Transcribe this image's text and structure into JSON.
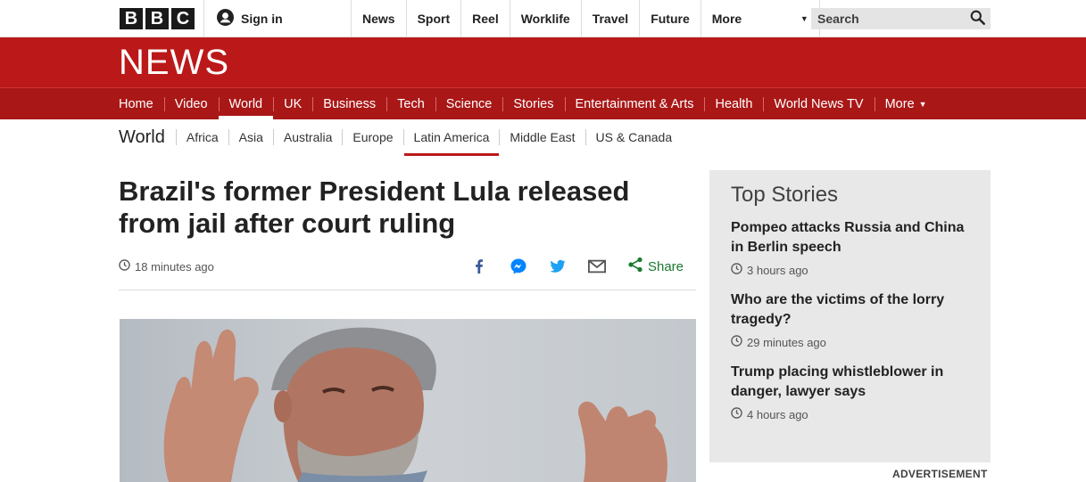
{
  "brand": {
    "logo_letters": [
      "B",
      "B",
      "C"
    ],
    "news_wordmark": "NEWS"
  },
  "account": {
    "signin_label": "Sign in"
  },
  "global_nav": {
    "items": [
      "News",
      "Sport",
      "Reel",
      "Worklife",
      "Travel",
      "Future"
    ],
    "more_label": "More",
    "search_placeholder": "Search"
  },
  "section_nav": {
    "items": [
      "Home",
      "Video",
      "World",
      "UK",
      "Business",
      "Tech",
      "Science",
      "Stories",
      "Entertainment & Arts",
      "Health",
      "World News TV"
    ],
    "active": "World",
    "more_label": "More"
  },
  "world_nav": {
    "title": "World",
    "items": [
      "Africa",
      "Asia",
      "Australia",
      "Europe",
      "Latin America",
      "Middle East",
      "US & Canada"
    ],
    "active": "Latin America"
  },
  "article": {
    "headline": "Brazil's former President Lula released from jail after court ruling",
    "timestamp": "18 minutes ago",
    "share_label": "Share"
  },
  "top_stories": {
    "title": "Top Stories",
    "items": [
      {
        "title": "Pompeo attacks Russia and China in Berlin speech",
        "time": "3 hours ago"
      },
      {
        "title": "Who are the victims of the lorry tragedy?",
        "time": "29 minutes ago"
      },
      {
        "title": "Trump placing whistleblower in danger, lawyer says",
        "time": "4 hours ago"
      }
    ]
  },
  "advertisement_label": "ADVERTISEMENT",
  "colors": {
    "brand_red": "#bb1919",
    "nav_red": "#a91717",
    "share_green": "#1a7a2e",
    "facebook": "#3b5998",
    "messenger": "#0084ff",
    "twitter": "#1da1f2"
  }
}
